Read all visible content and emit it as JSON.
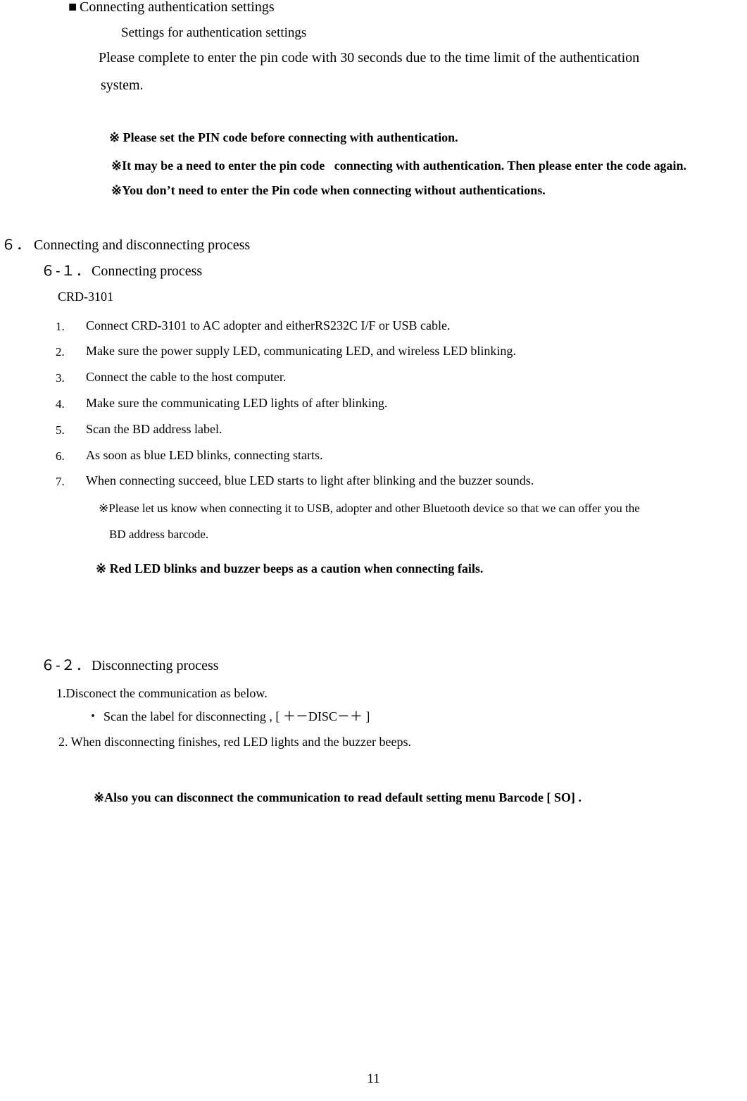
{
  "document": {
    "page_number": "11",
    "background_color": "#ffffff",
    "text_color": "#000000"
  },
  "auth_section": {
    "bullet": "■",
    "heading": "Connecting authentication settings",
    "subheading": "Settings for authentication settings",
    "paragraph_line1": "Please complete to enter the pin code with 30 seconds due to the time limit of the authentication",
    "paragraph_line2": "system.",
    "notices": [
      "※ Please set the PIN code before connecting with authentication.",
      "※It may be a need to enter the pin code   connecting with authentication. Then please enter the code again.",
      "※You don’t need to enter the Pin code when connecting without authentications."
    ]
  },
  "section6": {
    "number": "６．",
    "title": "Connecting and disconnecting process",
    "sub1": {
      "number": "６‐１．",
      "title": "Connecting process",
      "model": "CRD‐3101",
      "steps": [
        {
          "num": "1.",
          "text": "Connect CRD‐3101 to AC adopter and eitherRS232C I/F or USB cable."
        },
        {
          "num": "2.",
          "text": "Make sure the power supply LED, communicating LED, and wireless LED blinking."
        },
        {
          "num": "3.",
          "text": "Connect the cable to the host computer."
        },
        {
          "num": "4.",
          "text": "Make sure the communicating LED lights of after blinking."
        },
        {
          "num": "5.",
          "text": "Scan the BD address label."
        },
        {
          "num": "6.",
          "text": "As soon as blue LED blinks, connecting starts."
        },
        {
          "num": "7.",
          "text": "When connecting succeed, blue LED starts to light after blinking and the buzzer sounds."
        }
      ],
      "step_note_line1": "※Please let us know when connecting it to USB, adopter and other Bluetooth device so that we can offer you the",
      "step_note_line2": "BD address barcode.",
      "caution": "※ Red LED blinks and buzzer beeps as a caution when connecting fails."
    },
    "sub2": {
      "number": "６‐２．",
      "title": "Disconnecting process",
      "step1": "1.Disconect the communication as below.",
      "bullet_char": "・",
      "bullet_text": "Scan the label for disconnecting , [ ＋－DISC－＋ ]",
      "step2": "2. When disconnecting finishes, red LED lights and the buzzer beeps.",
      "final_note": "※Also you can disconnect the communication to read default setting menu Barcode [ SO] ."
    }
  }
}
